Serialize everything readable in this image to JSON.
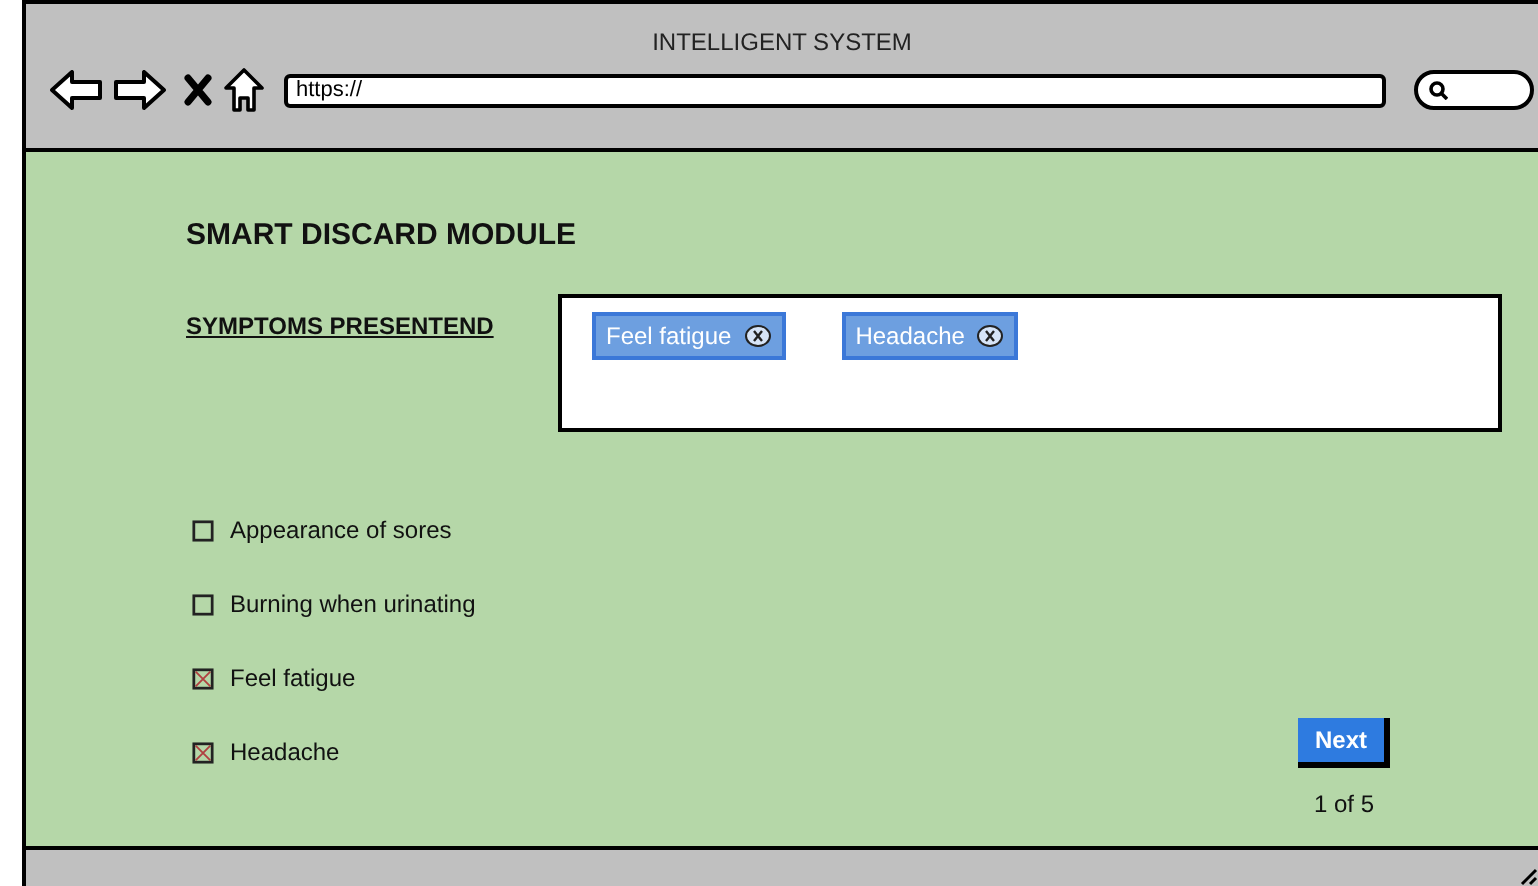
{
  "window": {
    "title": "INTELLIGENT SYSTEM"
  },
  "address_bar": {
    "value": "https://"
  },
  "module_title": "SMART DISCARD MODULE",
  "symptoms_label": "SYMPTOMS PRESENTEND",
  "tags": [
    {
      "label": "Feel fatigue"
    },
    {
      "label": "Headache"
    }
  ],
  "checkboxes": [
    {
      "label": "Appearance of sores",
      "checked": false
    },
    {
      "label": "Burning when urinating",
      "checked": false
    },
    {
      "label": "Feel fatigue",
      "checked": true
    },
    {
      "label": "Headache",
      "checked": true
    }
  ],
  "next_button": "Next",
  "pager": "1 of 5"
}
